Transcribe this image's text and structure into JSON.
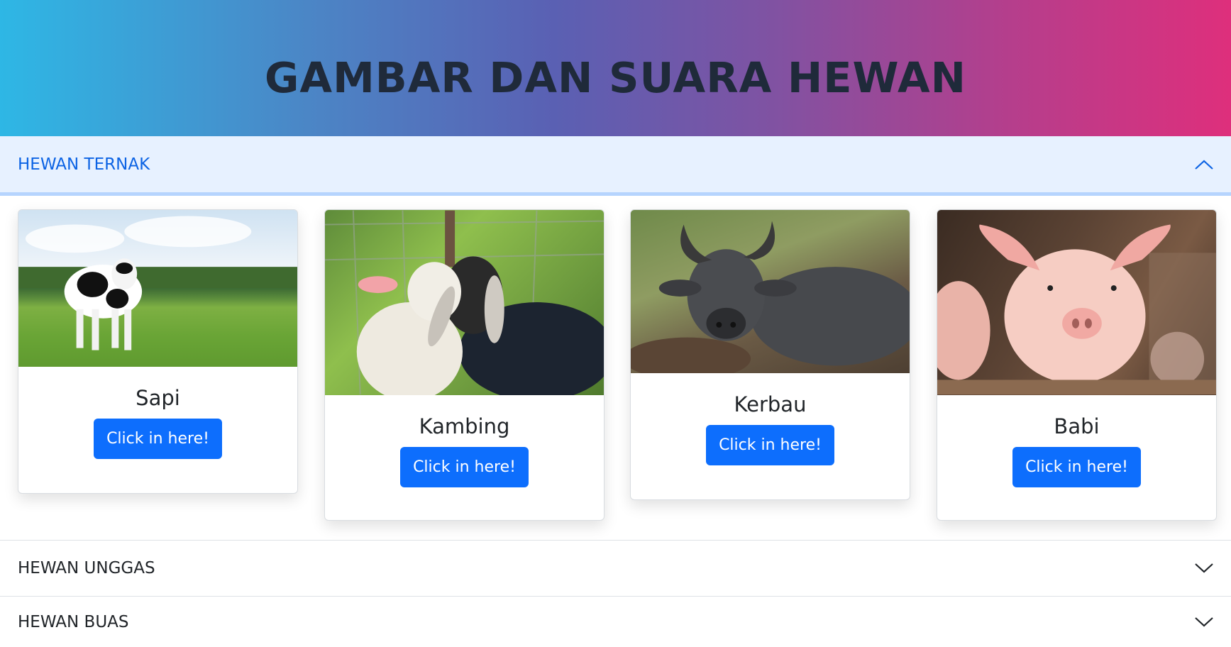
{
  "header": {
    "title": "GAMBAR DAN SUARA HEWAN"
  },
  "accordion": [
    {
      "label": "HEWAN TERNAK",
      "expanded": true
    },
    {
      "label": "HEWAN UNGGAS",
      "expanded": false
    },
    {
      "label": "HEWAN BUAS",
      "expanded": false
    }
  ],
  "cards": [
    {
      "name": "Sapi",
      "button": "Click in here!"
    },
    {
      "name": "Kambing",
      "button": "Click in here!"
    },
    {
      "name": "Kerbau",
      "button": "Click in here!"
    },
    {
      "name": "Babi",
      "button": "Click in here!"
    }
  ],
  "colors": {
    "accent": "#0d6efd",
    "accordion_active_bg": "#e7f1ff",
    "accordion_active_text": "#0c63e4"
  }
}
